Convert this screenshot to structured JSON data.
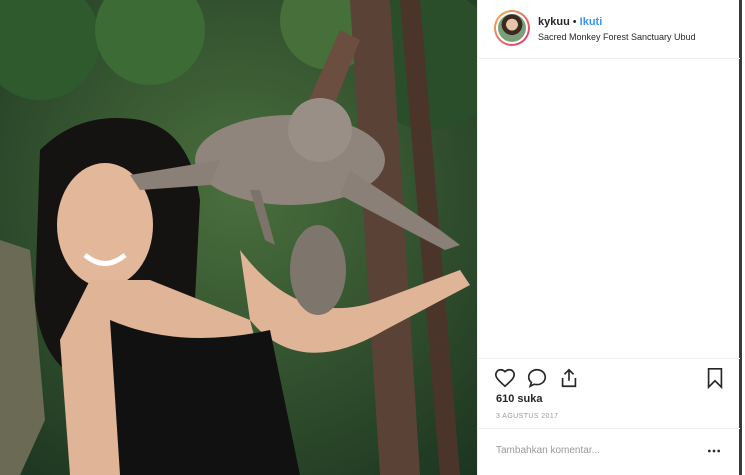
{
  "post": {
    "username": "kykuu",
    "separator": "•",
    "follow_label": "Ikuti",
    "location": "Sacred Monkey Forest Sanctuary Ubud",
    "likes": "610 suka",
    "date": "3 AGUSTUS 2017",
    "comment_placeholder": "Tambahkan komentar..."
  },
  "icons": {
    "like": "heart-icon",
    "comment": "comment-icon",
    "share": "share-icon",
    "save": "bookmark-icon",
    "more": "more-options-icon"
  },
  "colors": {
    "link_blue": "#3897f0",
    "text": "#262626",
    "muted": "#999999"
  }
}
